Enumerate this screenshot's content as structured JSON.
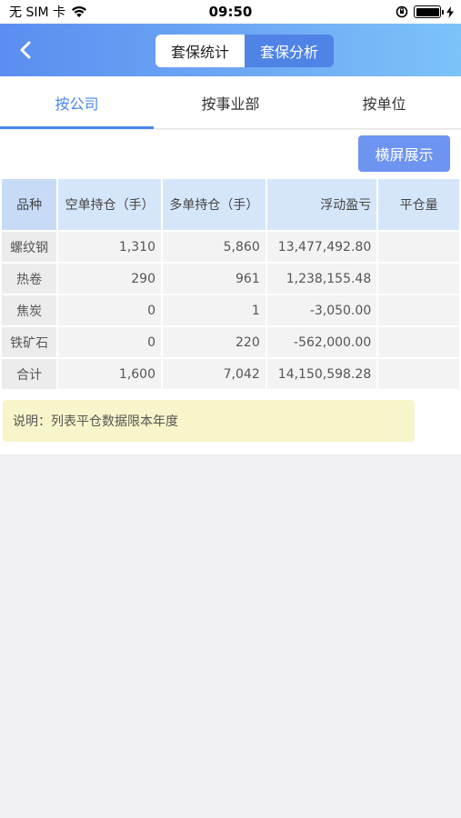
{
  "status": {
    "carrier": "无 SIM 卡",
    "time": "09:50"
  },
  "nav": {
    "segments": [
      {
        "label": "套保统计",
        "active": true
      },
      {
        "label": "套保分析",
        "active": false
      }
    ]
  },
  "tabs": [
    {
      "label": "按公司",
      "active": true
    },
    {
      "label": "按事业部",
      "active": false
    },
    {
      "label": "按单位",
      "active": false
    }
  ],
  "landscape_button": "横屏展示",
  "table": {
    "headers": [
      "品种",
      "空单持仓（手）",
      "多单持仓（手）",
      "浮动盈亏",
      "平仓量"
    ],
    "rows": [
      [
        "螺纹钢",
        "1,310",
        "5,860",
        "13,477,492.80",
        ""
      ],
      [
        "热卷",
        "290",
        "961",
        "1,238,155.48",
        ""
      ],
      [
        "焦炭",
        "0",
        "1",
        "-3,050.00",
        ""
      ],
      [
        "铁矿石",
        "0",
        "220",
        "-562,000.00",
        ""
      ],
      [
        "合计",
        "1,600",
        "7,042",
        "14,150,598.28",
        ""
      ]
    ]
  },
  "note": "说明：列表平仓数据限本年度",
  "colors": {
    "accent": "#4a86e8",
    "nav_gradient_start": "#5b8ef0",
    "nav_gradient_end": "#7cc3f8",
    "button": "#6e94f2",
    "header_bg": "#d6e6fa",
    "note_bg": "#f7f5c9"
  }
}
